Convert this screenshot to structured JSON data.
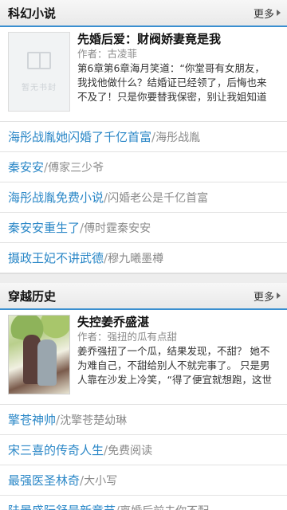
{
  "sections": [
    {
      "title": "科幻小说",
      "more_label": "更多",
      "feature": {
        "cover_text": "暂无书封",
        "title": "先婚后爱：财阀娇妻竟是我",
        "author": "作者：古凌菲",
        "desc_lines": [
          "第6章第6章海月笑道：“你堂哥有女朋友，",
          "我找他做什么？结婚证已经领了，后悔也来",
          "不及了！只是你要替我保密，别让我姐知道"
        ]
      },
      "items": [
        {
          "title": "海彤战胤她闪婚了千亿首富",
          "sub": "海彤战胤"
        },
        {
          "title": "秦安安",
          "sub": "傅家三少爷"
        },
        {
          "title": "海彤战胤免费小说",
          "sub": "闪婚老公是千亿首富"
        },
        {
          "title": "秦安安重生了",
          "sub": "傅时霆秦安安"
        },
        {
          "title": "摄政王妃不讲武德",
          "sub": "穆九曦墨樽"
        }
      ]
    },
    {
      "title": "穿越历史",
      "more_label": "更多",
      "feature": {
        "title": "失控姜乔盛湛",
        "author": "作者：强扭的瓜有点甜",
        "desc_lines": [
          "姜乔强扭了一个瓜，结果发现，不甜？ 她不",
          "为难自己，不甜给别人不就完事了。 只是男",
          "人靠在沙发上冷笑，“得了便宜就想跑，这世"
        ]
      },
      "items": [
        {
          "title": "擎苍神帅",
          "sub": "沈擎苍楚幼琳"
        },
        {
          "title": "宋三喜的传奇人生",
          "sub": "免费阅读"
        },
        {
          "title": "最强医圣林奇",
          "sub": "大小写"
        },
        {
          "title": "陆景盛阮舒最新章节",
          "sub": "离婚后前夫你不配"
        }
      ]
    }
  ],
  "separator": "/"
}
